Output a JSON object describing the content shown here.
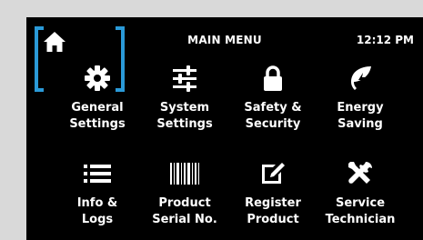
{
  "header": {
    "title": "MAIN MENU",
    "time": "12:12 PM"
  },
  "menu": [
    {
      "label": "General\nSettings",
      "icon": "gear-icon"
    },
    {
      "label": "System\nSettings",
      "icon": "sliders-icon"
    },
    {
      "label": "Safety &\nSecurity",
      "icon": "lock-icon"
    },
    {
      "label": "Energy\nSaving",
      "icon": "leaf-icon"
    },
    {
      "label": "Info &\nLogs",
      "icon": "list-icon"
    },
    {
      "label": "Product\nSerial No.",
      "icon": "barcode-icon"
    },
    {
      "label": "Register\nProduct",
      "icon": "edit-icon"
    },
    {
      "label": "Service\nTechnician",
      "icon": "tools-icon"
    }
  ],
  "colors": {
    "screen_bg": "#000000",
    "text": "#ffffff",
    "highlight": "#2a9ad8",
    "frame_bg": "#d9d9d9"
  }
}
